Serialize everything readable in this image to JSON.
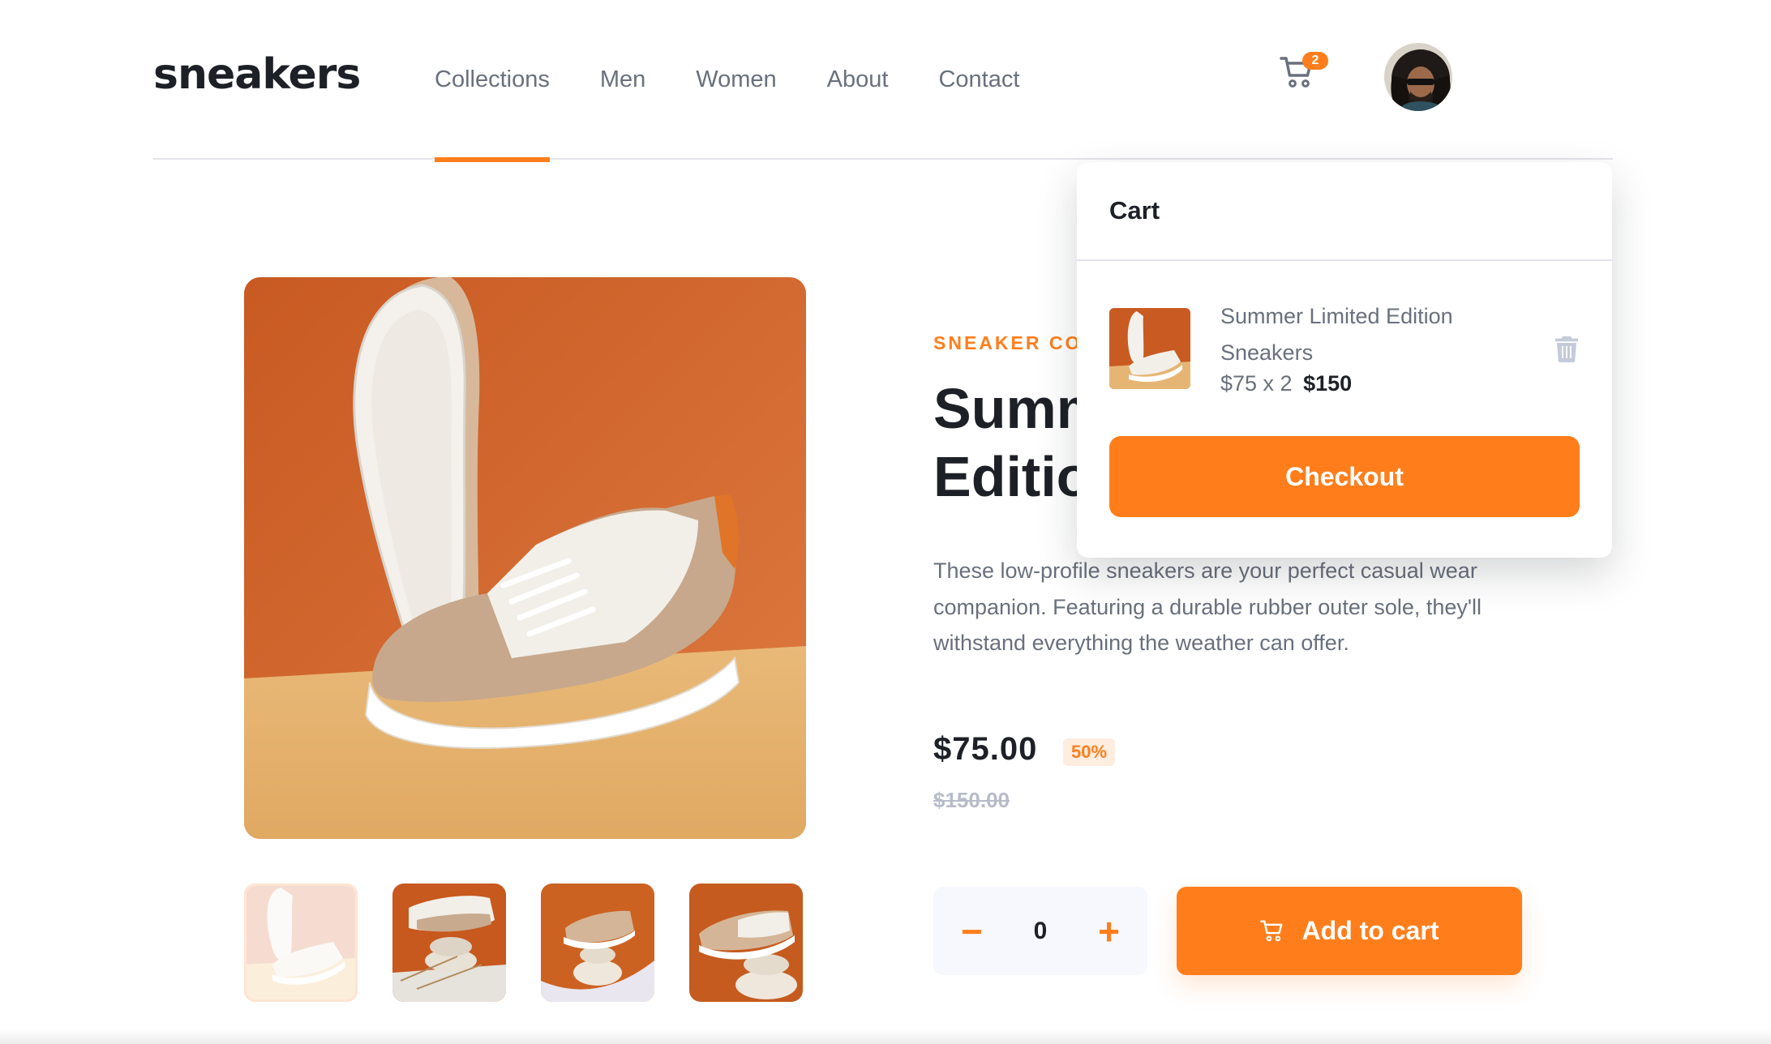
{
  "header": {
    "logo": "sneakers",
    "nav": [
      "Collections",
      "Men",
      "Women",
      "About",
      "Contact"
    ],
    "active_nav": "Collections",
    "cart_count": "2",
    "cart_icon": "cart-icon",
    "avatar": "user-avatar"
  },
  "gallery": {
    "thumbnail_count": 4,
    "selected_thumbnail": 1
  },
  "product": {
    "brand": "SNEAKER COMPANY",
    "title": "Summer Limited Edition Sneakers",
    "description": "These low-profile sneakers are your perfect casual wear companion. Featuring a durable rubber outer sole, they'll withstand everything the weather can offer.",
    "price": "$75.00",
    "discount": "50%",
    "old_price": "$150.00",
    "quantity": "0",
    "minus_label": "−",
    "plus_label": "+",
    "add_to_cart": "Add to cart"
  },
  "cart": {
    "heading": "Cart",
    "item_name": "Summer Limited Edition Sneakers",
    "item_price": "$75 x 2",
    "item_total": "$150",
    "checkout": "Checkout"
  },
  "colors": {
    "accent": "#ff7e1b",
    "accent_pale": "#ffede0",
    "dark": "#1d2026",
    "grey_text": "#69707d",
    "light_grey": "#b6bcc8"
  }
}
